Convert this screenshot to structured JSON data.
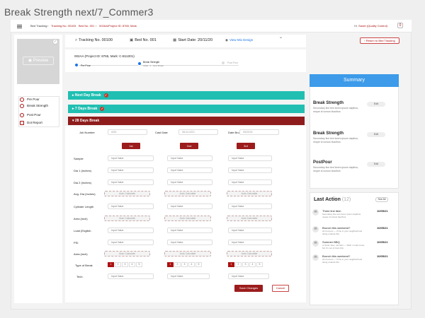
{
  "page_title": "Break Strength next/7_Commer3",
  "topbar": {
    "breadcrumbs": [
      "Bed Tracking",
      "Tracking No. 00100",
      "Bed No. 001",
      "002AA/Project ID: 8765, Mark"
    ],
    "user_prefix": "Hi,",
    "user_name": "Sarah (Quality Control)",
    "bell": "0"
  },
  "sidebar": {
    "preview_label": "Preview",
    "nav": [
      "Pre Pour",
      "Break Strength",
      "Post Pour",
      "Dot Report"
    ]
  },
  "header": {
    "tracking": "Tracking No. 00100",
    "bed": "Bed No. 001",
    "start_date": "Start Date: 20/11/20",
    "view_design": "View Mix Design",
    "return_label": "Return to Bed Tracking"
  },
  "info": {
    "project": "002AA (Project ID: 8765, Mark: C-B11001)",
    "steps": [
      {
        "label": "Pre Pour",
        "sub": ""
      },
      {
        "label": "Break Strength",
        "sub": "Initial - 1 - Next Break"
      },
      {
        "label": "Post Pour",
        "sub": ""
      }
    ]
  },
  "accordions": [
    "Next Day Break",
    "7 Days Break",
    "28 Days Break"
  ],
  "form": {
    "job_label": "Job Number",
    "job_value": "#001",
    "cast_label": "Cast Date",
    "cast_value": "08-04-2021",
    "date_broke_label": "Date Broke",
    "date_broke_value": "05/20/24",
    "columns": [
      "1st",
      "2nd",
      "3rd"
    ],
    "rows": [
      {
        "label": "Sample",
        "type": "input"
      },
      {
        "label": "Dia 1 (Inches)",
        "type": "input"
      },
      {
        "label": "Dia 2 (Inches)",
        "type": "input"
      },
      {
        "label": "Avg. Dia (Inches)",
        "type": "auto"
      },
      {
        "label": "Cylinder Length",
        "type": "input"
      },
      {
        "label": "Area (inch)",
        "type": "auto"
      },
      {
        "label": "Load (English",
        "type": "input"
      },
      {
        "label": "PSI",
        "type": "input"
      },
      {
        "label": "Area (inch)",
        "type": "auto"
      }
    ],
    "input_placeholder": "Input Value",
    "auto_placeholder": "Auto Calculate",
    "break_label": "Type of Break",
    "break_options": [
      "1",
      "2",
      "3",
      "4",
      "5"
    ],
    "tech_label": "Tech.",
    "save": "Save Changes",
    "cancel": "Cancel"
  },
  "summary": {
    "title": "Summary",
    "items": [
      {
        "title": "Break Strength",
        "desc": "Secondary line text lorem ipsum dapibus, neque id cursus faucibus",
        "pill": "Edit"
      },
      {
        "title": "Break Strength",
        "desc": "Secondary line text lorem ipsum dapibus, neque id cursus faucibus",
        "pill": "Edit"
      },
      {
        "title": "PostPour",
        "desc": "Secondary line text lorem ipsum dapibus, neque id cursus faucibus",
        "pill": "Edit"
      }
    ]
  },
  "last_action": {
    "title": "Last Action",
    "count": "(12)",
    "see_all": "See All",
    "items": [
      {
        "title": "Three line item",
        "desc": "Secondary line text lorem ipsum dapibus, neque id cursus faucibus",
        "date": "10/05/21"
      },
      {
        "title": "Brunch this weekend?",
        "desc": "Ali Connors — I'll be in your neighborhood doing errands this",
        "date": "10/05/21"
      },
      {
        "title": "Summer BBQ",
        "desc": "to Scott, Alex, Jennifer — Wish I could come, but I'm out of town this",
        "date": "10/05/21"
      },
      {
        "title": "Brunch this weekend?",
        "desc": "Ali Connors — I'll be in your neighborhood doing errands this",
        "date": "10/05/21"
      }
    ]
  }
}
